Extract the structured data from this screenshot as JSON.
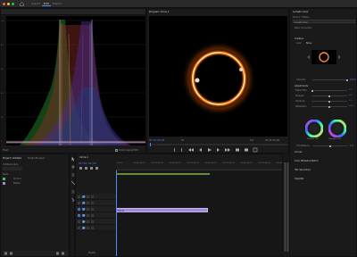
{
  "menu": {
    "items": [
      "Import",
      "Edit",
      "Export"
    ],
    "active_index": 1
  },
  "scopes": {
    "tabs": [
      "Source: (no clips)",
      "Lumetri Scopes",
      "Effect Controls",
      "Audio Clip Mixer: Circle 1"
    ],
    "active_index": 1,
    "readout": "Float",
    "clamp_label": "Clamp Signal",
    "bit_label": "8 Bit"
  },
  "program": {
    "title": "Program: Circle 1",
    "timecode": "00;00;00;00",
    "fit": "Fit",
    "quality": "Full",
    "duration": "00;00;05;00"
  },
  "project": {
    "tabs": [
      "Project: Untitled",
      "Media Browser"
    ],
    "active_index": 0,
    "name": "Untitled.prproj",
    "items": [
      "Circle 1",
      "Ellipse"
    ]
  },
  "timeline": {
    "tab": "Circle 1",
    "timecode": "00;00;00;00",
    "ruler": [
      ";00;00",
      "00;00;00;15",
      "00;00;01;00",
      "00;00;01;15",
      "00;00;02;00",
      "00;00;02;15",
      "00;00;03;00",
      "00;00;03;15",
      "00;00;04;00",
      "00;00;04;15"
    ],
    "video_tracks": [
      "V3",
      "V2",
      "V1"
    ],
    "audio_tracks": [
      "A1",
      "A2",
      "A3"
    ],
    "clip_name": "Ellipse",
    "master": "Master"
  },
  "lumetri": {
    "title": "Lumetri Color",
    "sequence": "Circle 1 * Ellipse",
    "effect": "Lumetri Color",
    "sections": [
      "Basic Correction",
      "Creative",
      "Curves",
      "Color Wheels & Match",
      "HSL Secondary",
      "Vignette"
    ],
    "look_label": "Look",
    "look_value": "None",
    "intensity_label": "Intensity",
    "intensity_value": "100.0",
    "adjustments_label": "Adjustments",
    "sliders": [
      {
        "label": "Faded Film",
        "value": "0.0",
        "pos": 0.0
      },
      {
        "label": "Sharpen",
        "value": "0.0",
        "pos": 0.5
      },
      {
        "label": "Vibrance",
        "value": "0.0",
        "pos": 0.5
      },
      {
        "label": "Saturation",
        "value": "100.0",
        "pos": 0.5
      }
    ],
    "wheels": [
      "Shadow Tint",
      "Highlight Tint"
    ],
    "tint_balance_label": "Tint Balance",
    "tint_balance_value": "0.0"
  },
  "colors": {
    "accent": "#4a8cf7",
    "clip": "#a18ad8",
    "timecode": "#4d7fe6",
    "playhead": "#4a8cf7"
  }
}
